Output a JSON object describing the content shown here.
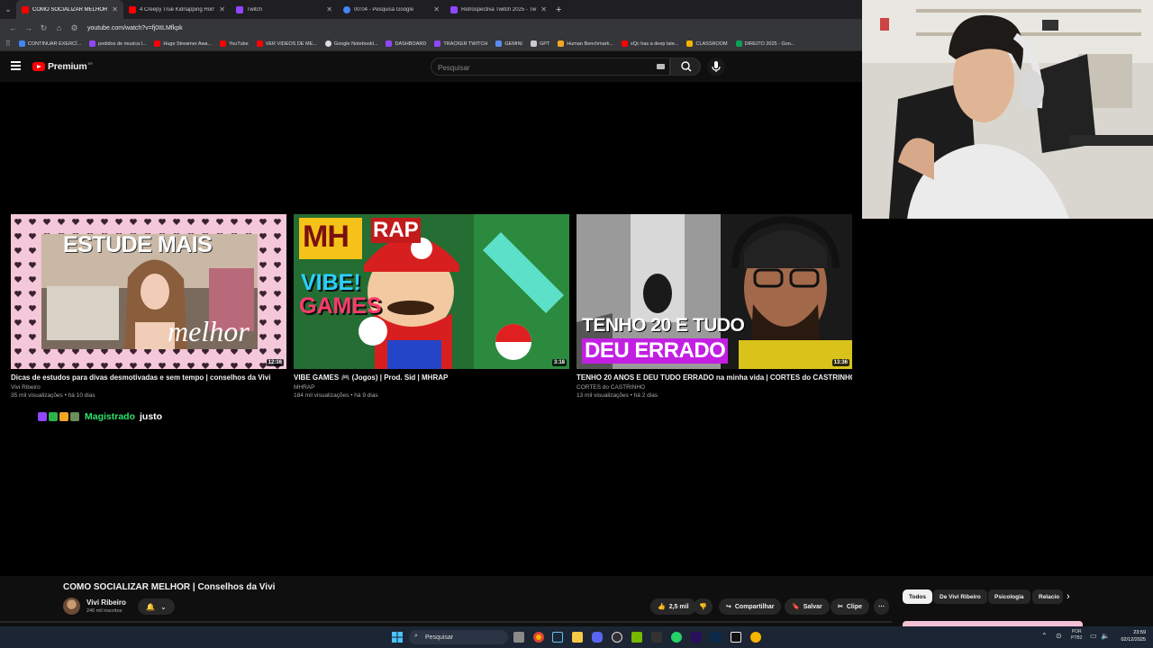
{
  "browser": {
    "tabs": [
      {
        "title": "COMO SOCIALIZAR MELHOR |",
        "favicon_color": "#ff0000",
        "active": true
      },
      {
        "title": "4 Creepy True Kidnapping Horr",
        "favicon_color": "#ff0000",
        "active": false
      },
      {
        "title": "Twitch",
        "favicon_color": "#9146ff",
        "active": false
      },
      {
        "title": "00:04 - Pesquisa Google",
        "favicon_color": "#4285f4",
        "active": false
      },
      {
        "title": "Retrospectiva Twitch 2025 - Tw",
        "favicon_color": "#9146ff",
        "active": false
      }
    ],
    "url": "youtube.com/watch?v=fj0ItLMfkpk",
    "bookmarks": [
      {
        "label": "CONTINUAR EXERCÍ...",
        "color": "#4285f4"
      },
      {
        "label": "pedidos de musica l...",
        "color": "#9146ff"
      },
      {
        "label": "Huge Streamer Awa...",
        "color": "#ff0000"
      },
      {
        "label": "YouTube",
        "color": "#ff0000"
      },
      {
        "label": "VER VIDEOS DE ME...",
        "color": "#ff0000"
      },
      {
        "label": "Google Notebookl...",
        "color": "#dddddd"
      },
      {
        "label": "DASHBOARD",
        "color": "#9146ff"
      },
      {
        "label": "TRACKER TWITCH",
        "color": "#9146ff"
      },
      {
        "label": "GEMINI",
        "color": "#5b8def"
      },
      {
        "label": "GPT",
        "color": "#cccccc"
      },
      {
        "label": "Human Benchmark...",
        "color": "#f5a623"
      },
      {
        "label": "xQc has a deep late...",
        "color": "#ff0000"
      },
      {
        "label": "CLASSROOM",
        "color": "#f4b400"
      },
      {
        "label": "DIREITO 2025 - Goo...",
        "color": "#0f9d58"
      }
    ]
  },
  "youtube": {
    "logo_text": "Premium",
    "logo_region": "BR",
    "search_placeholder": "Pesquisar",
    "videos": [
      {
        "title": "Dicas de estudos para divas desmotivadas e sem tempo | conselhos da Vivi",
        "channel": "Vivi Ribeiro",
        "meta": "35 mil visualizações • há 10 dias",
        "duration": "12:16",
        "thumb_text_top": "ESTUDE MAIS",
        "thumb_text_bottom": "melhor"
      },
      {
        "title": "VIBE GAMES 🎮 (Jogos) | Prod. Sid | MHRAP",
        "channel": "MHRAP",
        "meta": "184 mil visualizações • há 9 dias",
        "duration": "3:18",
        "thumb_text_top": "MH",
        "thumb_text_rap": "RAP",
        "thumb_text_vibe": "VIBE!",
        "thumb_text_games": "GAMES"
      },
      {
        "title": "TENHO 20 ANOS E DEU TUDO ERRADO na minha vida | CORTES do CASTRINHO",
        "channel": "CORTES do CASTRINHO",
        "meta": "13 mil visualizações • há 2 dias",
        "duration": "13:36",
        "thumb_text_top": "TENHO 20 E TUDO",
        "thumb_text_bottom": "DEU ERRADO"
      }
    ],
    "watch": {
      "title": "COMO SOCIALIZAR MELHOR | Conselhos da Vivi",
      "channel": "Vivi Ribeiro",
      "subscribers": "246 mil inscritos",
      "likes": "2,5 mil",
      "share_label": "Compartilhar",
      "save_label": "Salvar",
      "clip_label": "Clipe",
      "chips": [
        "Todos",
        "De Vivi Ribeiro",
        "Psicologia",
        "Relacio"
      ]
    }
  },
  "chat": {
    "username": "Magistrado",
    "message": "justo",
    "username_color": "#2fe36a"
  },
  "taskbar": {
    "search_placeholder": "Pesquisar",
    "lang": "POR",
    "layout": "PTB2",
    "time": "23:59",
    "date": "02/12/2025"
  }
}
